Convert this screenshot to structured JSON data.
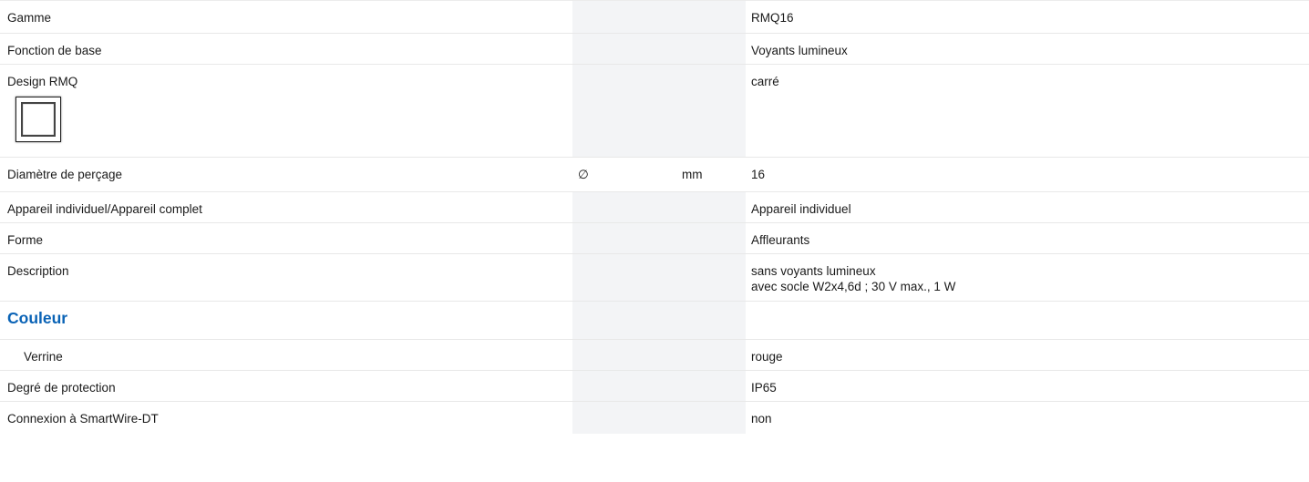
{
  "rows": [
    {
      "label": "Gamme",
      "symbol": "",
      "unit": "",
      "value": "RMQ16"
    },
    {
      "label": "Fonction de base",
      "symbol": "",
      "unit": "",
      "value": "Voyants lumineux"
    },
    {
      "label": "Design RMQ",
      "symbol": "",
      "unit": "",
      "value": "carré",
      "icon": "square-design-icon"
    },
    {
      "label": "Diamètre de perçage",
      "symbol": "∅",
      "unit": "mm",
      "value": "16"
    },
    {
      "label": "Appareil individuel/Appareil complet",
      "symbol": "",
      "unit": "",
      "value": "Appareil individuel"
    },
    {
      "label": "Forme",
      "symbol": "",
      "unit": "",
      "value": "Affleurants"
    },
    {
      "label": "Description",
      "symbol": "",
      "unit": "",
      "value_lines": [
        "sans voyants lumineux",
        "avec socle W2x4,6d ; 30 V max., 1 W"
      ]
    },
    {
      "label": "Couleur",
      "section": true,
      "accent_color": "#0a63b6"
    },
    {
      "label": "Verrine",
      "symbol": "",
      "unit": "",
      "value": "rouge",
      "indent": true
    },
    {
      "label": "Degré de protection",
      "symbol": "",
      "unit": "",
      "value": "IP65"
    },
    {
      "label": "Connexion à SmartWire-DT",
      "symbol": "",
      "unit": "",
      "value": "non"
    }
  ]
}
